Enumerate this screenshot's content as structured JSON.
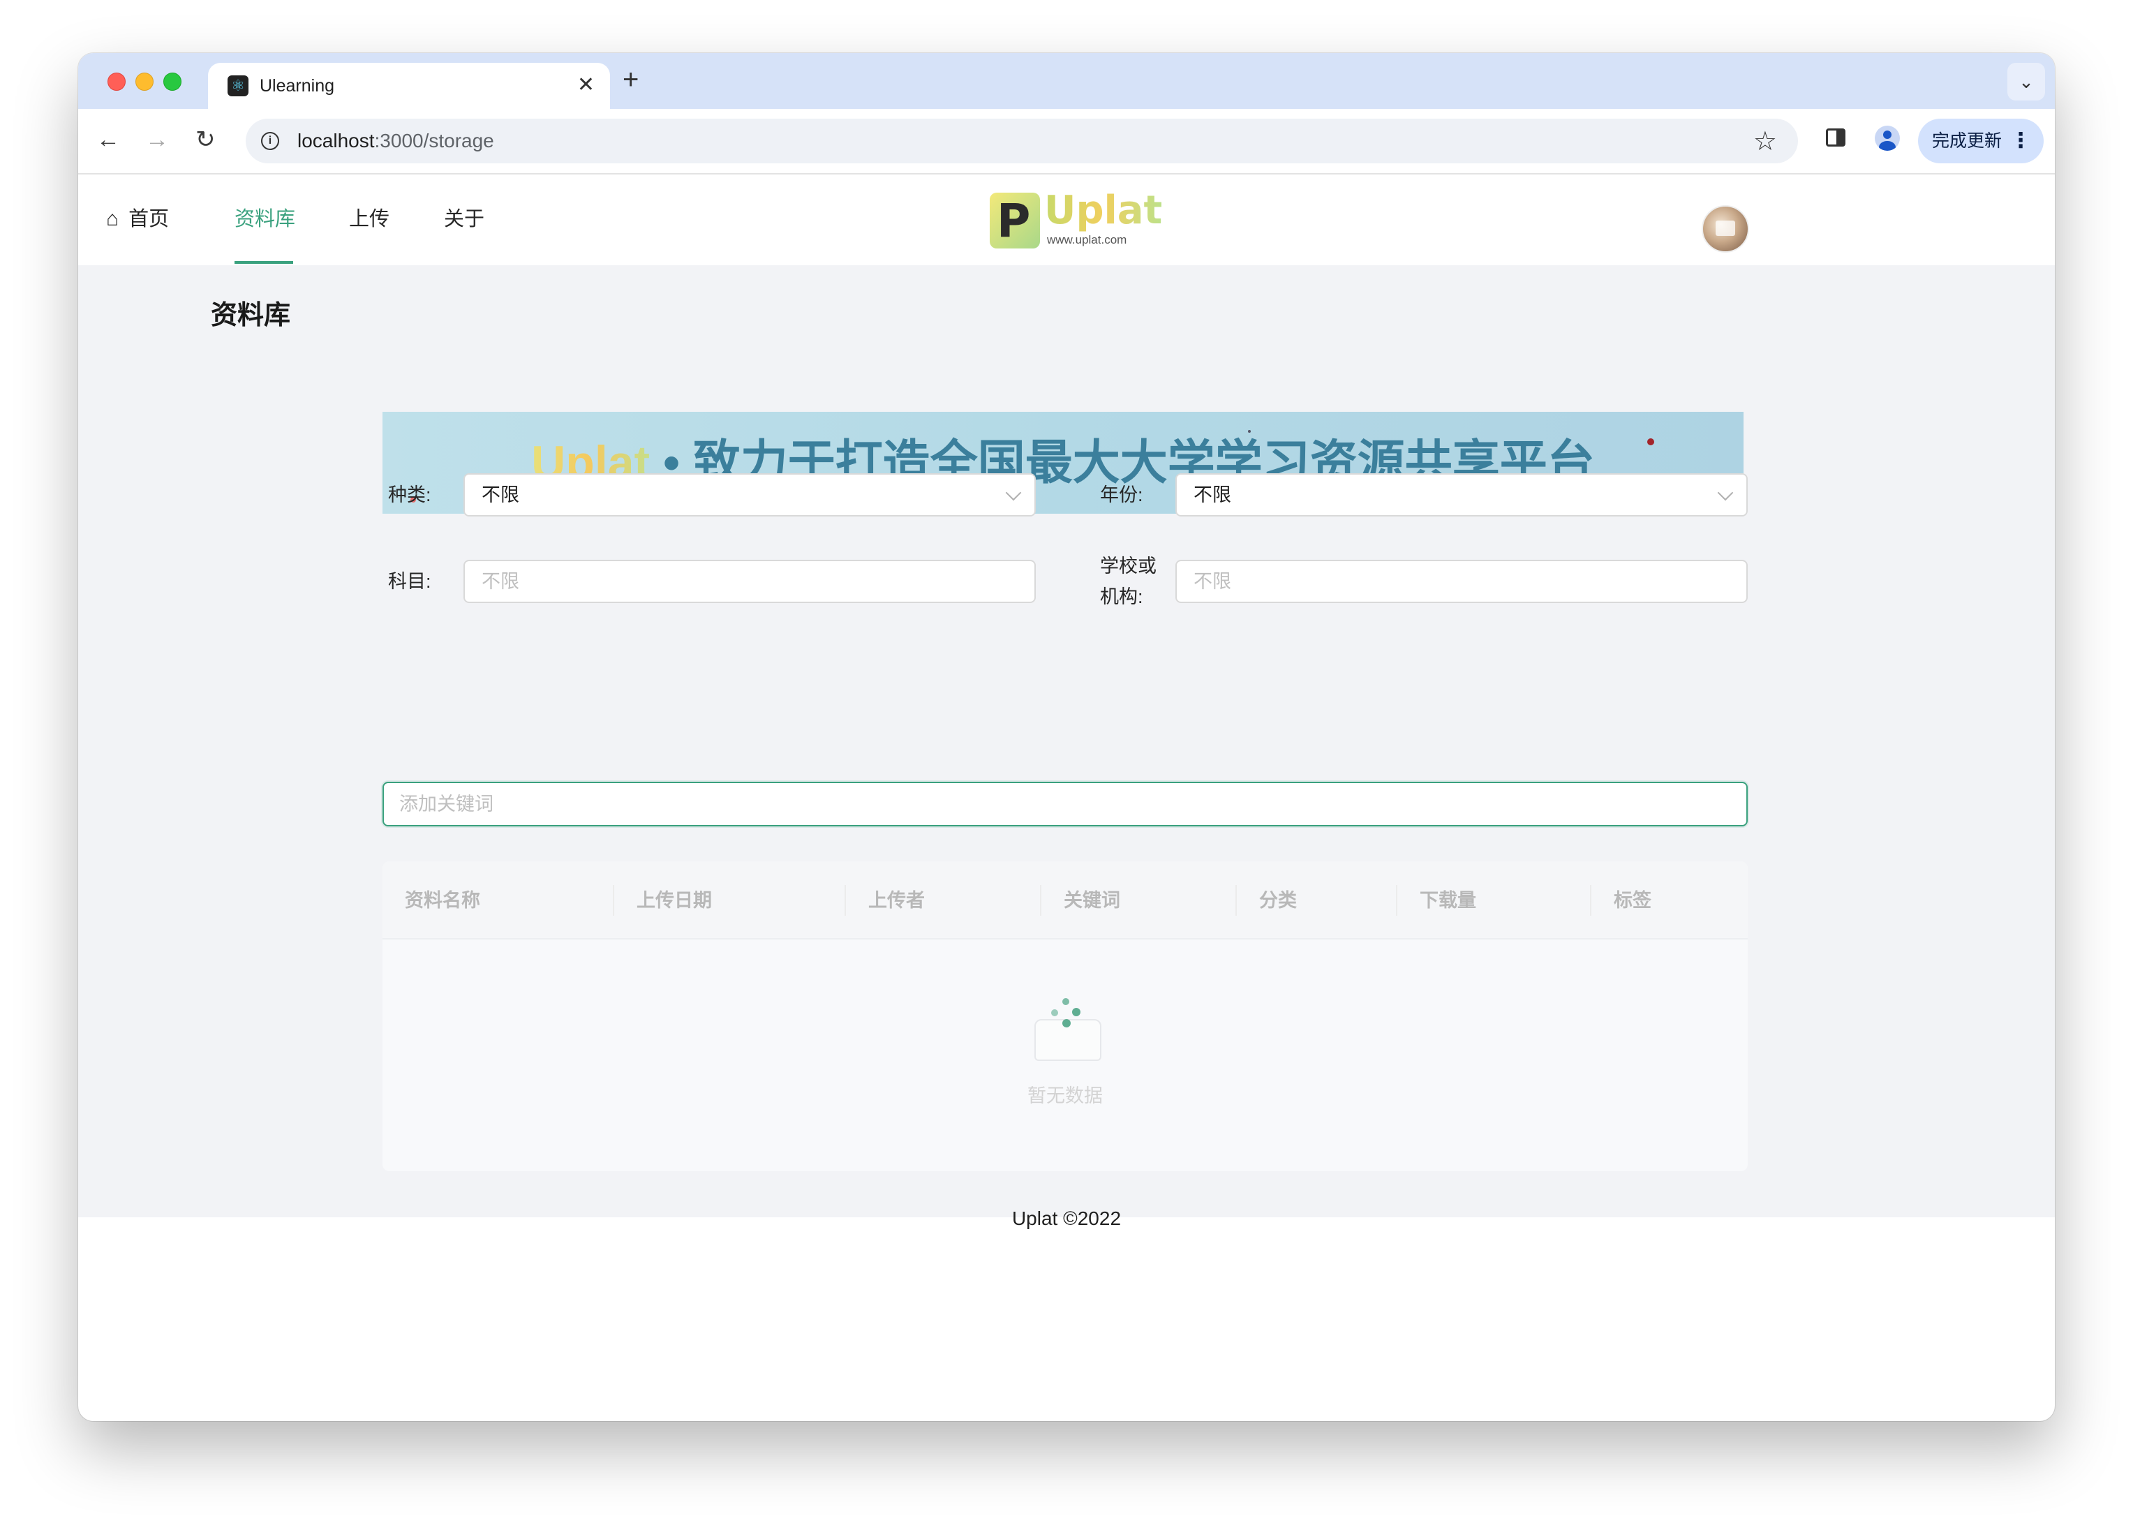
{
  "browser": {
    "tab": {
      "title": "Ulearning",
      "close": "✕"
    },
    "new_tab": "+",
    "url_host": "localhost",
    "url_rest": ":3000/storage",
    "update_label": "完成更新",
    "icons": {
      "back": "←",
      "forward": "→",
      "reload": "↻",
      "info": "i",
      "star": "☆",
      "menu": "⋮",
      "dropdown": "⌄",
      "favicon": "⚛"
    }
  },
  "app": {
    "nav": {
      "home": "首页",
      "library": "资料库",
      "upload": "上传",
      "about": "关于",
      "active": "资料库",
      "accent_color": "#3aa17e"
    },
    "logo": {
      "badge": "P",
      "word": "Uplat",
      "url": "www.uplat.com"
    }
  },
  "page": {
    "title": "资料库",
    "banner": {
      "brand": "Uplat",
      "separator": "•",
      "slogan": "致力于打造全国最大大学学习资源共享平台"
    },
    "filters": {
      "category": {
        "label": "种类:",
        "value": "不限"
      },
      "year": {
        "label": "年份:",
        "value": "不限"
      },
      "subject": {
        "label": "科目:",
        "placeholder": "不限"
      },
      "school": {
        "label_line1": "学校或",
        "label_line2": "机构:",
        "placeholder": "不限"
      }
    },
    "keyword": {
      "placeholder": "添加关键词"
    },
    "table": {
      "columns": [
        "资料名称",
        "上传日期",
        "上传者",
        "关键词",
        "分类",
        "下载量",
        "标签"
      ],
      "rows": [],
      "empty_text": "暂无数据"
    },
    "footer": "Uplat ©2022"
  }
}
